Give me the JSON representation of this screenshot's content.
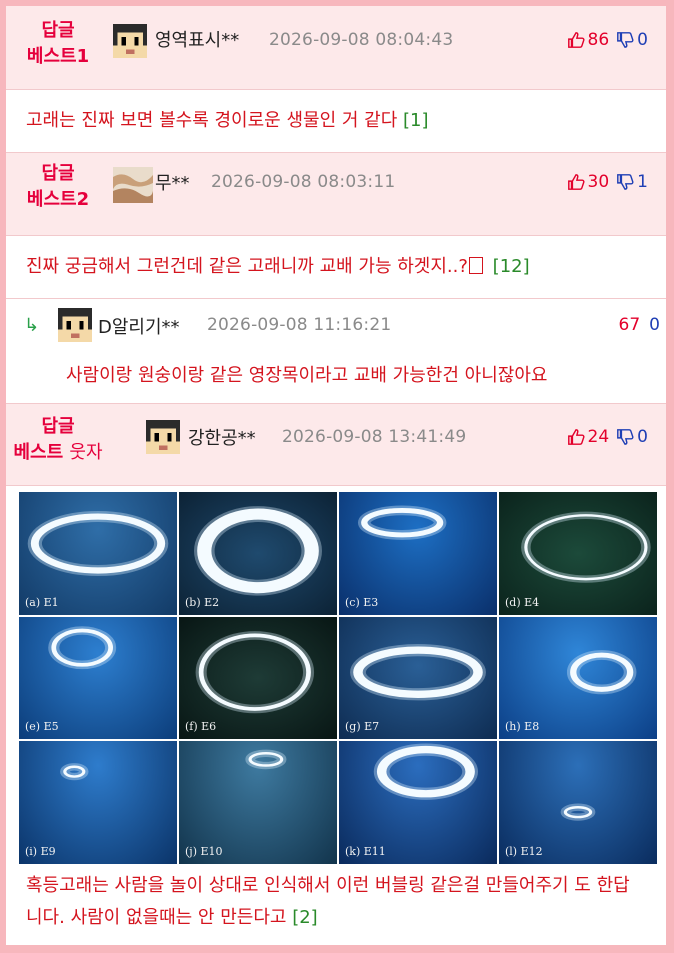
{
  "comments": [
    {
      "badge_line1": "답글",
      "badge_line2": "베스트1",
      "nickname": "영역표시**",
      "date": "2026-09-08 08:04:43",
      "likes": "86",
      "dislikes": "0",
      "text": "고래는 진짜 보면 볼수록 경이로운 생물인 거 같다",
      "ref": "[1]"
    },
    {
      "badge_line1": "답글",
      "badge_line2": "베스트2",
      "nickname": "무**",
      "date": "2026-09-08 08:03:11",
      "likes": "30",
      "dislikes": "1",
      "text": "진짜 궁금해서 그런건데 같은 고래니까 교배 가능 하겟지..?",
      "ref": "[12]"
    },
    {
      "badge_line1": "답글",
      "badge_line2": "베스트",
      "badge_suffix": "웃자",
      "nickname": "강한공**",
      "date": "2026-09-08 13:41:49",
      "likes": "24",
      "dislikes": "0",
      "text": "혹등고래는 사람을 놀이 상대로 인식해서 이런 버블링 같은걸 만들어주기 도 한답니다. 사람이 없을때는 안 만든다고",
      "ref": "[2]"
    }
  ],
  "reply": {
    "arrow": "↳",
    "nickname": "D알리기**",
    "date": "2026-09-08 11:16:21",
    "likes": "67",
    "dislikes": "0",
    "text": "사람이랑 원숭이랑 같은 영장목이라고 교배 가능한건 아니잖아요"
  },
  "image_grid": {
    "labels": [
      "(a) E1",
      "(b) E2",
      "(c) E3",
      "(d) E4",
      "(e) E5",
      "(f) E6",
      "(g) E7",
      "(h) E8",
      "(i) E9",
      "(j) E10",
      "(k) E11",
      "(l) E12"
    ]
  },
  "colors": {
    "accent": "#e5003c",
    "header_bg": "#fde9ea",
    "frame_border": "#f7b7bd",
    "like": "#e3002b",
    "dislike": "#1f3fb5",
    "ref": "#2a8a2a"
  },
  "icons": {
    "like": "thumbs-up-icon",
    "dislike": "thumbs-down-icon",
    "avatar": "pixel-avatar-icon",
    "reply": "reply-arrow-icon"
  }
}
